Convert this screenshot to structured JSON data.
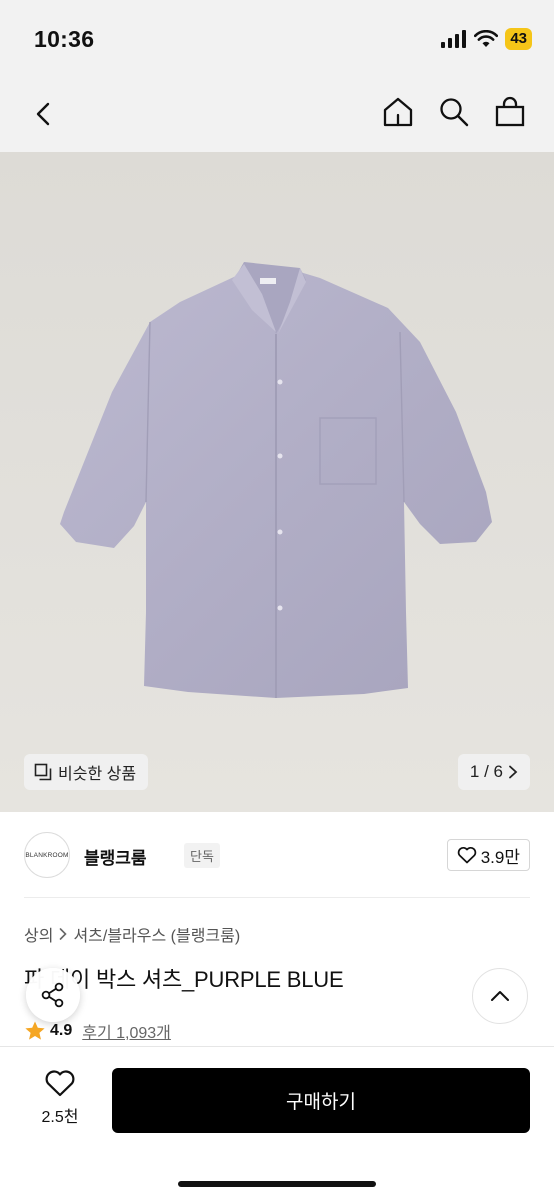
{
  "status_bar": {
    "time": "10:36",
    "battery": "43"
  },
  "nav": {
    "icons": [
      "chevron-left-icon",
      "home-icon",
      "search-icon",
      "shopping-bag-icon"
    ]
  },
  "hero": {
    "similar_label": "비슷한 상품",
    "page_counter": "1 / 6"
  },
  "brand": {
    "logo_text": "BLANKROOM",
    "name": "블랭크룸",
    "tag": "단독",
    "likes": "3.9만"
  },
  "breadcrumb": {
    "category": "상의",
    "subcategory": "셔츠/블라우스 (블랭크룸)"
  },
  "product": {
    "title": "파 데이 박스 셔츠_PURPLE BLUE",
    "rating": "4.9",
    "reviews": "후기 1,093개"
  },
  "bottom": {
    "wish_count": "2.5천",
    "buy_label": "구매하기"
  },
  "colors": {
    "accent": "#000000",
    "star": "#f5a623",
    "shirt": "#b3b0c8",
    "battery": "#f5c518"
  }
}
